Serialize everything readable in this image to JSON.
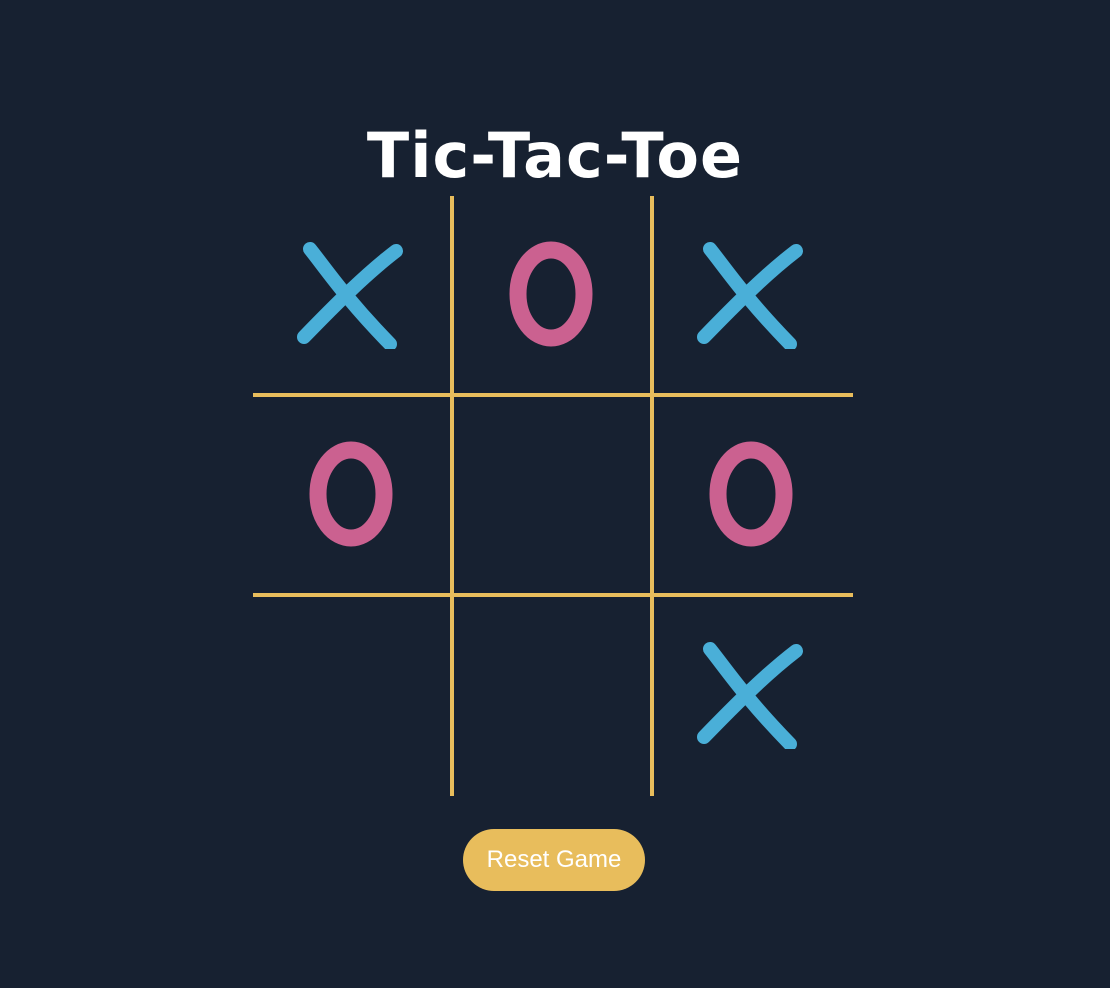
{
  "title": "Tic-Tac-Toe",
  "board": [
    "X",
    "O",
    "X",
    "O",
    "",
    "O",
    "",
    "",
    "X"
  ],
  "marks": {
    "X": {
      "label": "X",
      "color": "#4aafd8",
      "icon": "x-mark-icon"
    },
    "O": {
      "label": "O",
      "color": "#cb6190",
      "icon": "o-mark-icon"
    }
  },
  "grid_color": "#e8bd5c",
  "background_color": "#172131",
  "reset_button": {
    "label": "Reset Game",
    "color": "#e8bd5c"
  }
}
